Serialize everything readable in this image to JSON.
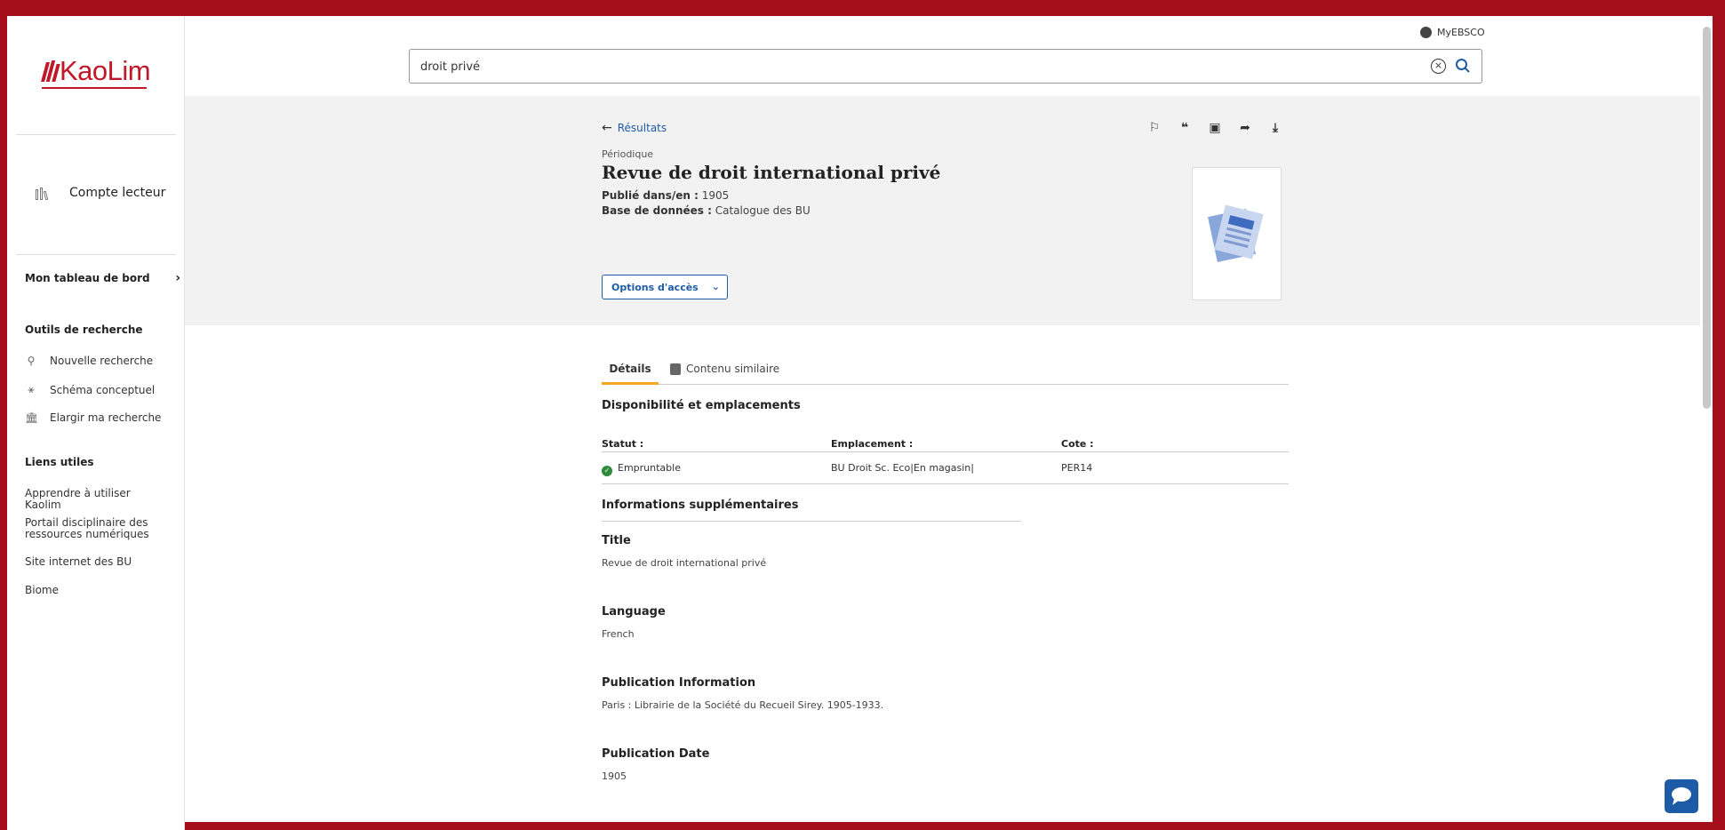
{
  "brand": {
    "logo_text": "KaoLim"
  },
  "header": {
    "search_value": "droit privé",
    "search_placeholder": "",
    "account_label": "MyEBSCO"
  },
  "sidebar": {
    "account": "Compte lecteur",
    "dashboard": "Mon tableau de bord",
    "tools_title": "Outils de recherche",
    "tools": [
      {
        "label": "Nouvelle recherche",
        "icon": "search-icon"
      },
      {
        "label": "Schéma conceptuel",
        "icon": "concept-map-icon"
      },
      {
        "label": "Elargir ma recherche",
        "icon": "institution-icon"
      }
    ],
    "links_title": "Liens utiles",
    "links": [
      "Apprendre à utiliser Kaolim",
      "Portail disciplinaire des ressources numériques",
      "Site internet des BU",
      "Biome"
    ]
  },
  "record": {
    "back_label": "Résultats",
    "type": "Périodique",
    "title": "Revue de droit international privé",
    "published_label": "Publié dans/en :",
    "published_value": "1905",
    "database_label": "Base de données :",
    "database_value": "Catalogue des BU",
    "access_button": "Options d'accès",
    "actions": [
      "bookmark-icon",
      "cite-icon",
      "add-folder-icon",
      "share-icon",
      "download-icon"
    ]
  },
  "tabs": [
    {
      "label": "Détails",
      "active": true
    },
    {
      "label": "Contenu similaire",
      "active": false
    }
  ],
  "availability": {
    "heading": "Disponibilité et emplacements",
    "columns": [
      "Statut :",
      "Emplacement :",
      "Cote :"
    ],
    "rows": [
      {
        "status": "Empruntable",
        "location": "BU Droit Sc. Eco|En magasin|",
        "cote": "PER14"
      }
    ]
  },
  "additional": {
    "heading": "Informations supplémentaires",
    "fields": [
      {
        "label": "Title",
        "value": "Revue de droit international privé"
      },
      {
        "label": "Language",
        "value": "French"
      },
      {
        "label": "Publication Information",
        "value": "Paris : Librairie de la Société du Recueil Sirey. 1905-1933."
      },
      {
        "label": "Publication Date",
        "value": "1905"
      }
    ]
  },
  "colors": {
    "frame": "#a50e1b",
    "brand": "#c01828",
    "link": "#1d5ba7",
    "tab_active": "#f5a623"
  }
}
